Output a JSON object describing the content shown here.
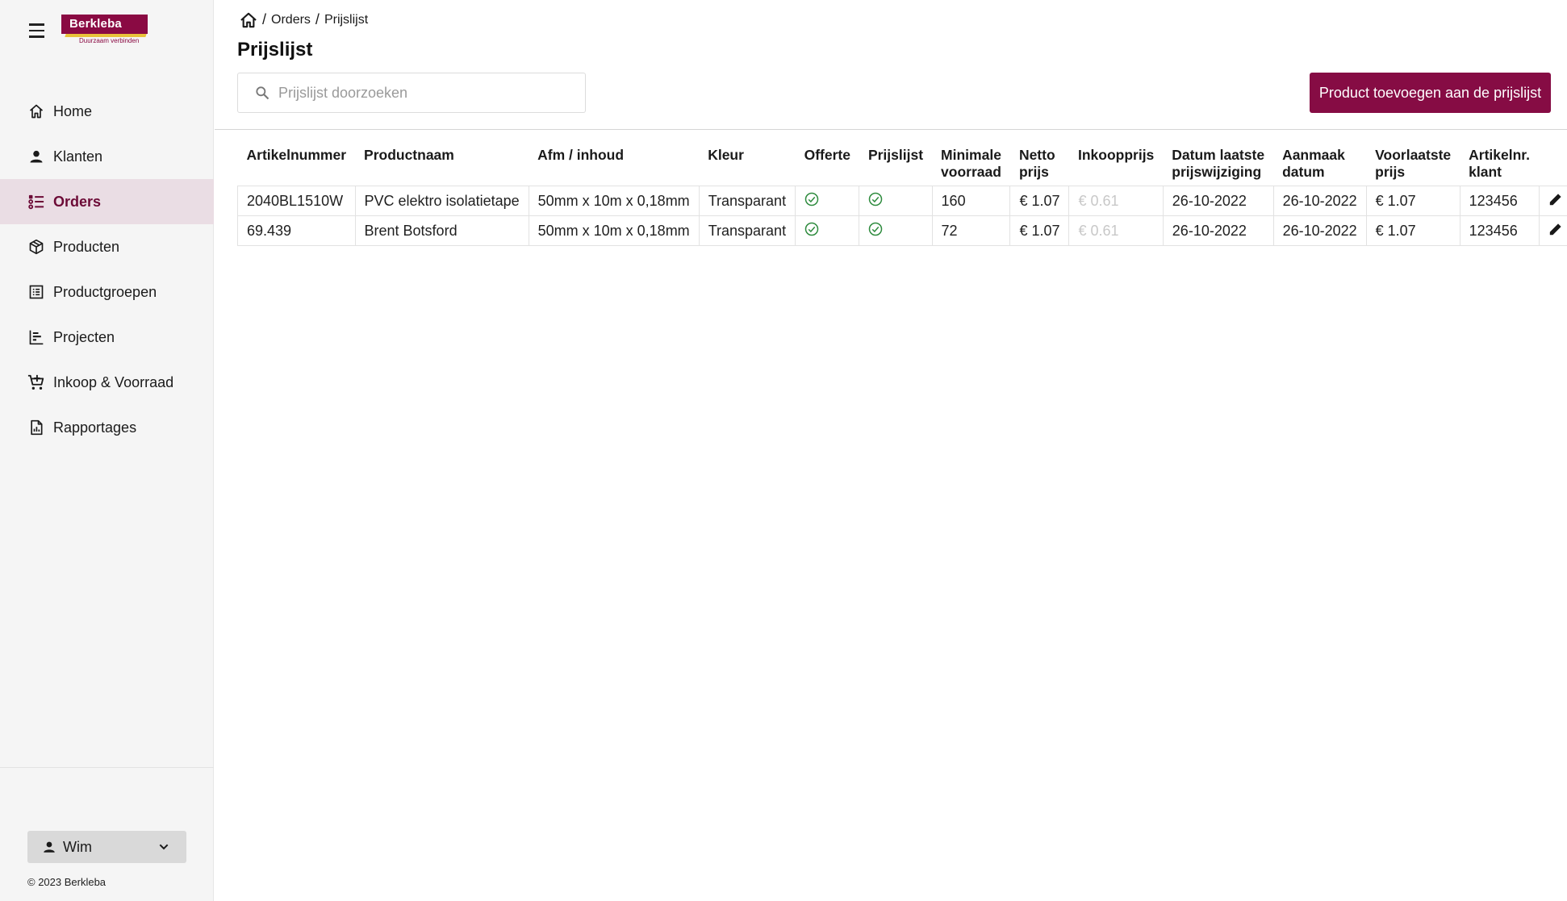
{
  "brand": {
    "name": "Berkleba",
    "tagline": "Duurzaam verbinden",
    "primary_color": "#860c44",
    "accent_color": "#e8c23a"
  },
  "sidebar": {
    "items": [
      {
        "label": "Home",
        "icon": "home-icon"
      },
      {
        "label": "Klanten",
        "icon": "person-icon"
      },
      {
        "label": "Orders",
        "icon": "list-icon",
        "active": true
      },
      {
        "label": "Producten",
        "icon": "package-icon"
      },
      {
        "label": "Productgroepen",
        "icon": "table-list-icon"
      },
      {
        "label": "Projecten",
        "icon": "timeline-chart-icon"
      },
      {
        "label": "Inkoop & Voorraad",
        "icon": "cart-icon"
      },
      {
        "label": "Rapportages",
        "icon": "report-icon"
      }
    ],
    "user": {
      "name": "Wim"
    },
    "copyright": "© 2023 Berkleba"
  },
  "breadcrumb": {
    "items": [
      "Orders",
      "Prijslijst"
    ],
    "separator": "/"
  },
  "page": {
    "title": "Prijslijst",
    "search_placeholder": "Prijslijst doorzoeken",
    "add_button": "Product toevoegen aan de prijslijst"
  },
  "table": {
    "headers": [
      {
        "line1": "Artikelnummer",
        "line2": ""
      },
      {
        "line1": "Productnaam",
        "line2": ""
      },
      {
        "line1": "Afm / inhoud",
        "line2": ""
      },
      {
        "line1": "Kleur",
        "line2": ""
      },
      {
        "line1": "Offerte",
        "line2": ""
      },
      {
        "line1": "Prijslijst",
        "line2": ""
      },
      {
        "line1": "Minimale",
        "line2": "voorraad"
      },
      {
        "line1": "Netto",
        "line2": "prijs"
      },
      {
        "line1": "Inkoopprijs",
        "line2": ""
      },
      {
        "line1": "Datum laatste",
        "line2": "prijswijziging"
      },
      {
        "line1": "Aanmaak",
        "line2": "datum"
      },
      {
        "line1": "Voorlaatste",
        "line2": "prijs"
      },
      {
        "line1": "Artikelnr.",
        "line2": "klant"
      }
    ],
    "rows": [
      {
        "artikelnummer": "2040BL1510W",
        "productnaam": "PVC elektro isolatietape",
        "afmeting": "50mm x 10m x 0,18mm",
        "kleur": "Transparant",
        "offerte": true,
        "prijslijst": true,
        "minimale_voorraad": "160",
        "netto_prijs": "€ 1.07",
        "inkoopprijs": "€ 0.61",
        "datum_laatste_prijswijziging": "26-10-2022",
        "aanmaak_datum": "26-10-2022",
        "voorlaatste_prijs": "€ 1.07",
        "artikelnr_klant": "123456"
      },
      {
        "artikelnummer": "69.439",
        "productnaam": "Brent Botsford",
        "afmeting": "50mm x 10m x 0,18mm",
        "kleur": "Transparant",
        "offerte": true,
        "prijslijst": true,
        "minimale_voorraad": "72",
        "netto_prijs": "€ 1.07",
        "inkoopprijs": "€ 0.61",
        "datum_laatste_prijswijziging": "26-10-2022",
        "aanmaak_datum": "26-10-2022",
        "voorlaatste_prijs": "€ 1.07",
        "artikelnr_klant": "123456"
      }
    ]
  }
}
